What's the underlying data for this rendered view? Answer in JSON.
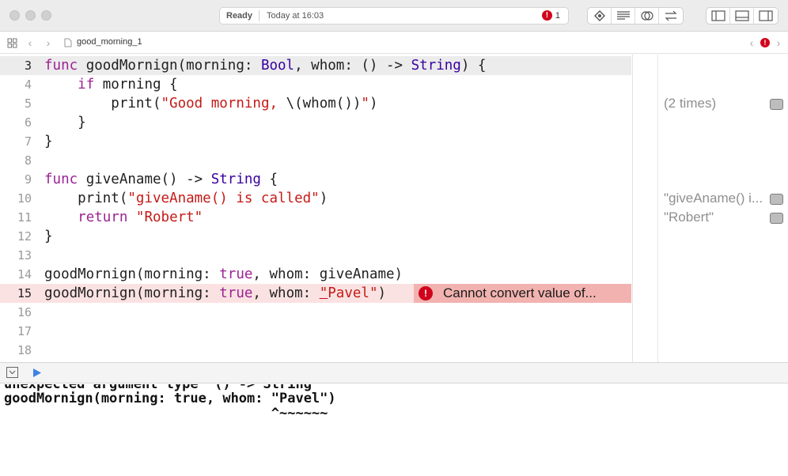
{
  "toolbar": {
    "status_ready": "Ready",
    "status_time": "Today at 16:03",
    "error_count": "1"
  },
  "jumpbar": {
    "filename": "good_morning_1"
  },
  "editor": {
    "lines": [
      {
        "n": "3",
        "segments": [
          {
            "t": "func ",
            "c": "kw"
          },
          {
            "t": "goodMornign(morning: ",
            "c": ""
          },
          {
            "t": "Bool",
            "c": "ty"
          },
          {
            "t": ", whom: () -> ",
            "c": ""
          },
          {
            "t": "String",
            "c": "ty"
          },
          {
            "t": ") {",
            "c": ""
          }
        ]
      },
      {
        "n": "4",
        "segments": [
          {
            "t": "    ",
            "c": ""
          },
          {
            "t": "if",
            "c": "kw"
          },
          {
            "t": " morning {",
            "c": ""
          }
        ]
      },
      {
        "n": "5",
        "segments": [
          {
            "t": "        print(",
            "c": ""
          },
          {
            "t": "\"Good morning, ",
            "c": "str"
          },
          {
            "t": "\\(whom())",
            "c": ""
          },
          {
            "t": "\"",
            "c": "str"
          },
          {
            "t": ")",
            "c": ""
          }
        ]
      },
      {
        "n": "6",
        "segments": [
          {
            "t": "    }",
            "c": ""
          }
        ]
      },
      {
        "n": "7",
        "segments": [
          {
            "t": "}",
            "c": ""
          }
        ]
      },
      {
        "n": "8",
        "segments": []
      },
      {
        "n": "9",
        "segments": [
          {
            "t": "func ",
            "c": "kw"
          },
          {
            "t": "giveAname() -> ",
            "c": ""
          },
          {
            "t": "String",
            "c": "ty"
          },
          {
            "t": " {",
            "c": ""
          }
        ]
      },
      {
        "n": "10",
        "segments": [
          {
            "t": "    print(",
            "c": ""
          },
          {
            "t": "\"giveAname() is called\"",
            "c": "str"
          },
          {
            "t": ")",
            "c": ""
          }
        ]
      },
      {
        "n": "11",
        "segments": [
          {
            "t": "    ",
            "c": ""
          },
          {
            "t": "return",
            "c": "kw"
          },
          {
            "t": " ",
            "c": ""
          },
          {
            "t": "\"Robert\"",
            "c": "str"
          }
        ]
      },
      {
        "n": "12",
        "segments": [
          {
            "t": "}",
            "c": ""
          }
        ]
      },
      {
        "n": "13",
        "segments": []
      },
      {
        "n": "14",
        "segments": [
          {
            "t": "goodMornign(morning: ",
            "c": ""
          },
          {
            "t": "true",
            "c": "kw"
          },
          {
            "t": ", whom: giveAname)",
            "c": ""
          }
        ]
      },
      {
        "n": "15",
        "segments": [
          {
            "t": "goodMornign(morning: ",
            "c": ""
          },
          {
            "t": "true",
            "c": "kw"
          },
          {
            "t": ", whom: ",
            "c": ""
          },
          {
            "t": "\"",
            "c": "str ul"
          },
          {
            "t": "Pavel\"",
            "c": "str"
          },
          {
            "t": ")",
            "c": ""
          }
        ]
      },
      {
        "n": "16",
        "segments": []
      },
      {
        "n": "17",
        "segments": []
      },
      {
        "n": "18",
        "segments": []
      }
    ],
    "error_message": "Cannot convert value of..."
  },
  "results": [
    {
      "text": "(2 times)"
    },
    {
      "text": "\"giveAname() i..."
    },
    {
      "text": "\"Robert\""
    }
  ],
  "console": {
    "lines": [
      "unexpected argument type '() -> String'",
      "goodMornign(morning: true, whom: \"Pavel\")",
      "                                 ^~~~~~~"
    ]
  }
}
